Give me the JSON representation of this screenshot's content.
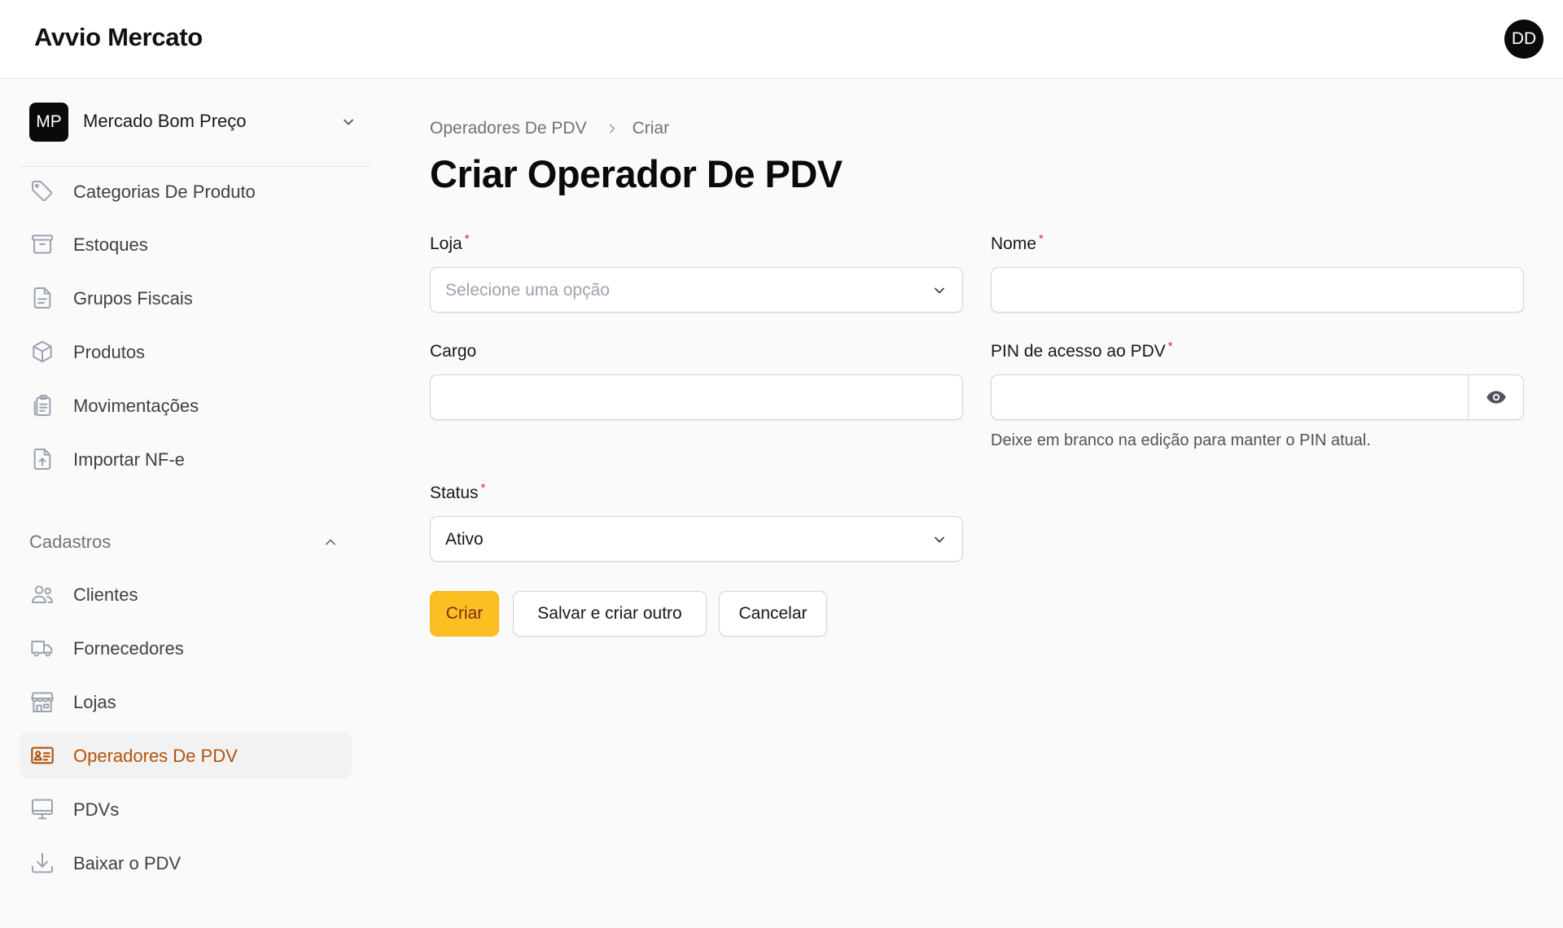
{
  "app": {
    "title": "Avvio Mercato"
  },
  "user": {
    "initials": "DD"
  },
  "tenant": {
    "initials": "MP",
    "name": "Mercado Bom Preço"
  },
  "sidebar": {
    "items": [
      {
        "label": "Categorias De Produto",
        "icon": "tag-icon"
      },
      {
        "label": "Estoques",
        "icon": "archive-box-icon"
      },
      {
        "label": "Grupos Fiscais",
        "icon": "document-icon"
      },
      {
        "label": "Produtos",
        "icon": "cube-icon"
      },
      {
        "label": "Movimentações",
        "icon": "clipboard-list-icon"
      },
      {
        "label": "Importar NF-e",
        "icon": "document-upload-icon"
      }
    ],
    "group": {
      "label": "Cadastros",
      "items": [
        {
          "label": "Clientes",
          "icon": "users-icon"
        },
        {
          "label": "Fornecedores",
          "icon": "truck-icon"
        },
        {
          "label": "Lojas",
          "icon": "storefront-icon"
        },
        {
          "label": "Operadores De PDV",
          "icon": "id-card-icon",
          "active": true
        },
        {
          "label": "PDVs",
          "icon": "monitor-icon"
        },
        {
          "label": "Baixar o PDV",
          "icon": "download-icon"
        }
      ]
    }
  },
  "breadcrumb": {
    "parent": "Operadores De PDV",
    "current": "Criar"
  },
  "page": {
    "title": "Criar Operador De PDV"
  },
  "form": {
    "loja": {
      "label": "Loja",
      "required_mark": "*",
      "placeholder": "Selecione uma opção"
    },
    "nome": {
      "label": "Nome",
      "required_mark": "*",
      "value": ""
    },
    "cargo": {
      "label": "Cargo",
      "value": ""
    },
    "pin": {
      "label": "PIN de acesso ao PDV",
      "required_mark": "*",
      "value": "",
      "hint": "Deixe em branco na edição para manter o PIN atual."
    },
    "status": {
      "label": "Status",
      "required_mark": "*",
      "value": "Ativo"
    }
  },
  "actions": {
    "create": "Criar",
    "save_and_create_another": "Salvar e criar outro",
    "cancel": "Cancelar"
  },
  "colors": {
    "accent": "#fbbf24",
    "active_nav_text": "#b45309",
    "required": "#dc2626"
  }
}
